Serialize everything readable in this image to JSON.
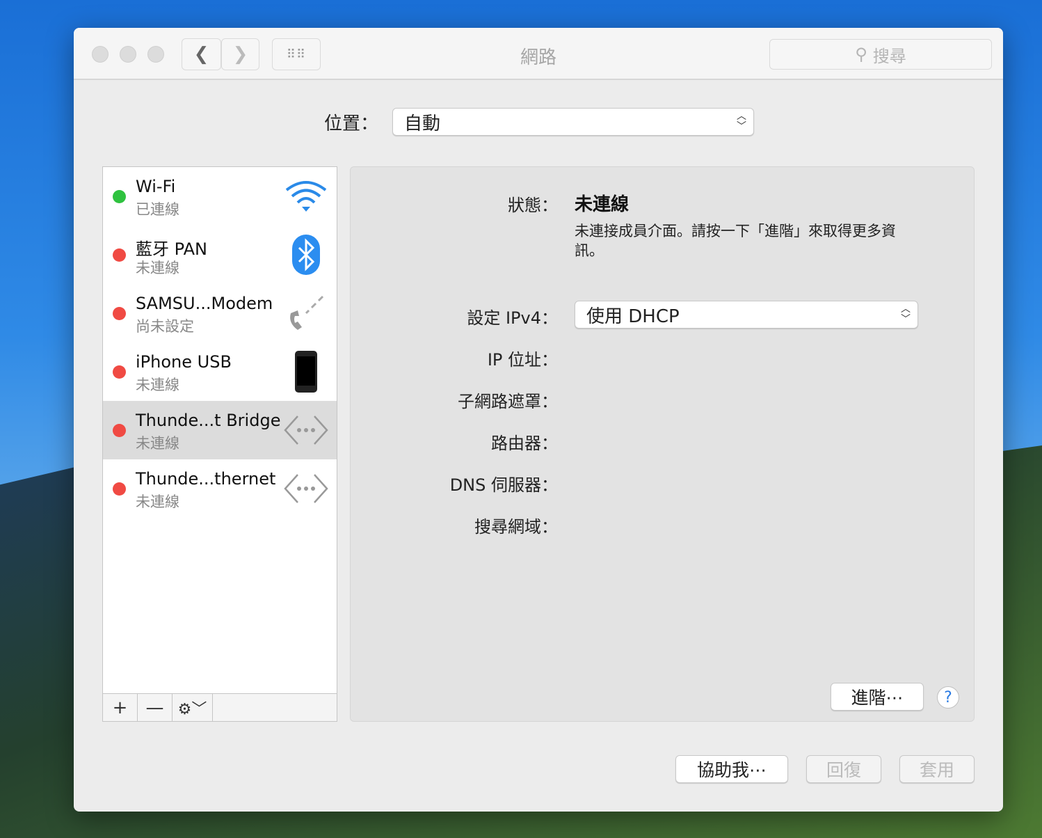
{
  "window": {
    "title": "網路",
    "search_placeholder": "搜尋"
  },
  "location": {
    "label": "位置：",
    "value": "自動"
  },
  "services": [
    {
      "name": "Wi-Fi",
      "status": "已連線",
      "status_color": "#2fc23f",
      "icon": "wifi-icon"
    },
    {
      "name": "藍牙 PAN",
      "status": "未連線",
      "status_color": "#f04a43",
      "icon": "bluetooth-icon"
    },
    {
      "name": "SAMSU...Modem",
      "status": "尚未設定",
      "status_color": "#f04a43",
      "icon": "phone-modem-icon"
    },
    {
      "name": "iPhone USB",
      "status": "未連線",
      "status_color": "#f04a43",
      "icon": "iphone-icon"
    },
    {
      "name": "Thunde...t Bridge",
      "status": "未連線",
      "status_color": "#f04a43",
      "icon": "ethernet-bridge-icon",
      "selected": true
    },
    {
      "name": "Thunde...thernet",
      "status": "未連線",
      "status_color": "#f04a43",
      "icon": "ethernet-icon"
    }
  ],
  "list_footer": {
    "add": "+",
    "remove": "—"
  },
  "detail": {
    "status_label": "狀態：",
    "status_value": "未連線",
    "status_desc": "未連接成員介面。請按一下「進階」來取得更多資訊。",
    "ipv4_label": "設定 IPv4：",
    "ipv4_value": "使用 DHCP",
    "ip_label": "IP 位址：",
    "subnet_label": "子網路遮罩：",
    "router_label": "路由器：",
    "dns_label": "DNS 伺服器：",
    "search_domain_label": "搜尋網域：",
    "advanced": "進階⋯",
    "help": "?"
  },
  "footer": {
    "assist": "協助我⋯",
    "revert": "回復",
    "apply": "套用"
  }
}
